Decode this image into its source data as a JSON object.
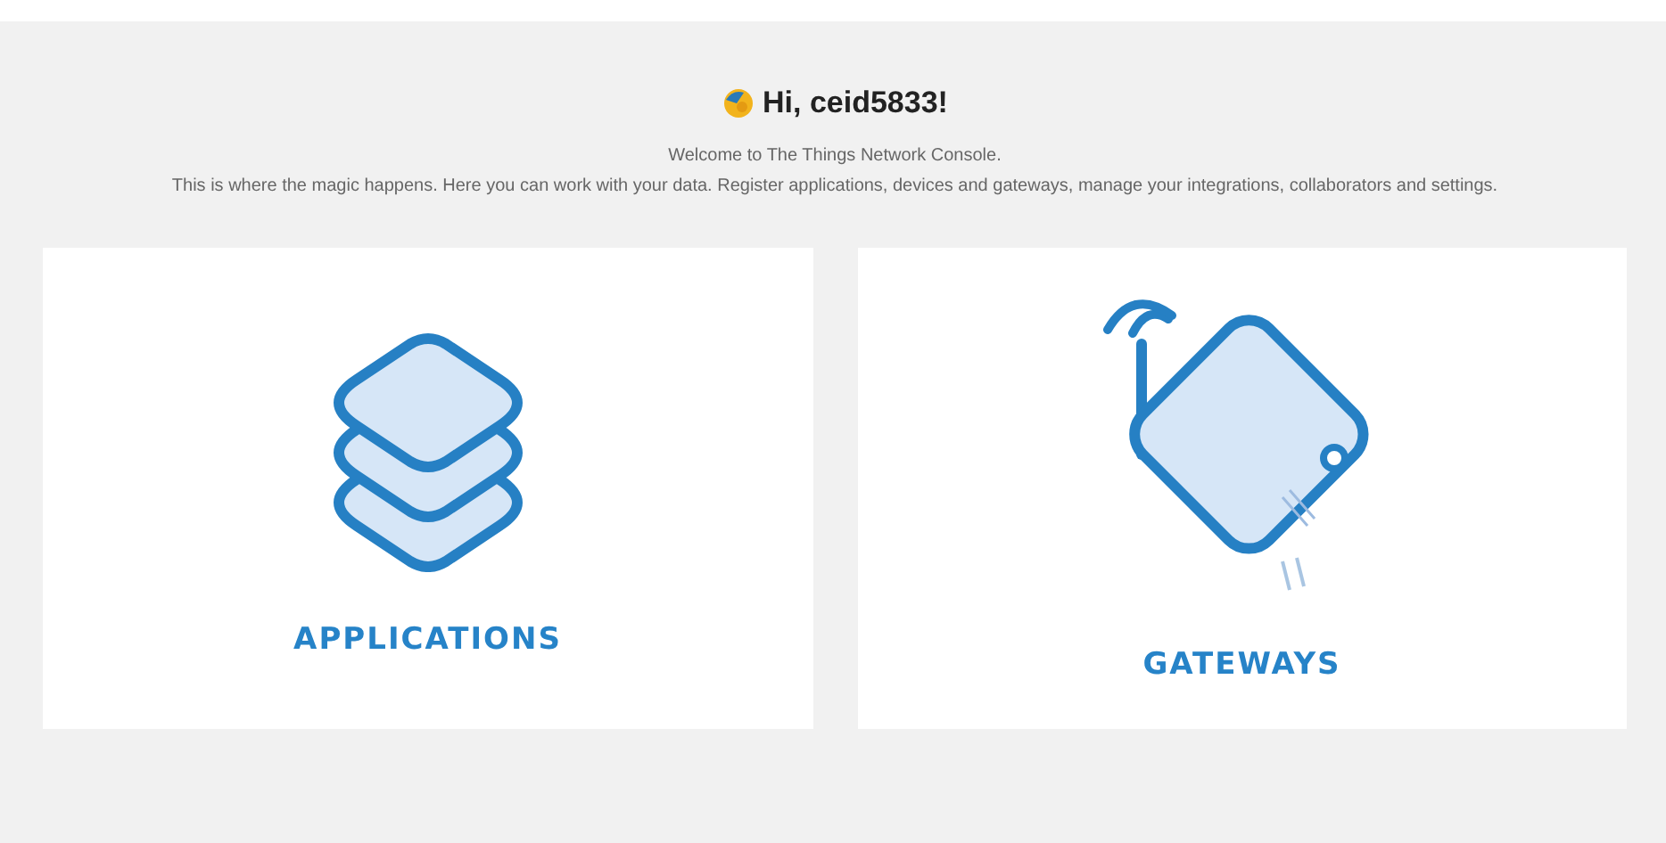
{
  "greeting": "Hi, ceid5833!",
  "intro": "Welcome to The Things Network Console.",
  "description": "This is where the magic happens. Here you can work with your data. Register applications, devices and gateways, manage your integrations, collaborators and settings.",
  "cards": [
    {
      "kind": "applications",
      "label": "APPLICATIONS"
    },
    {
      "kind": "gateways",
      "label": "GATEWAYS"
    }
  ]
}
